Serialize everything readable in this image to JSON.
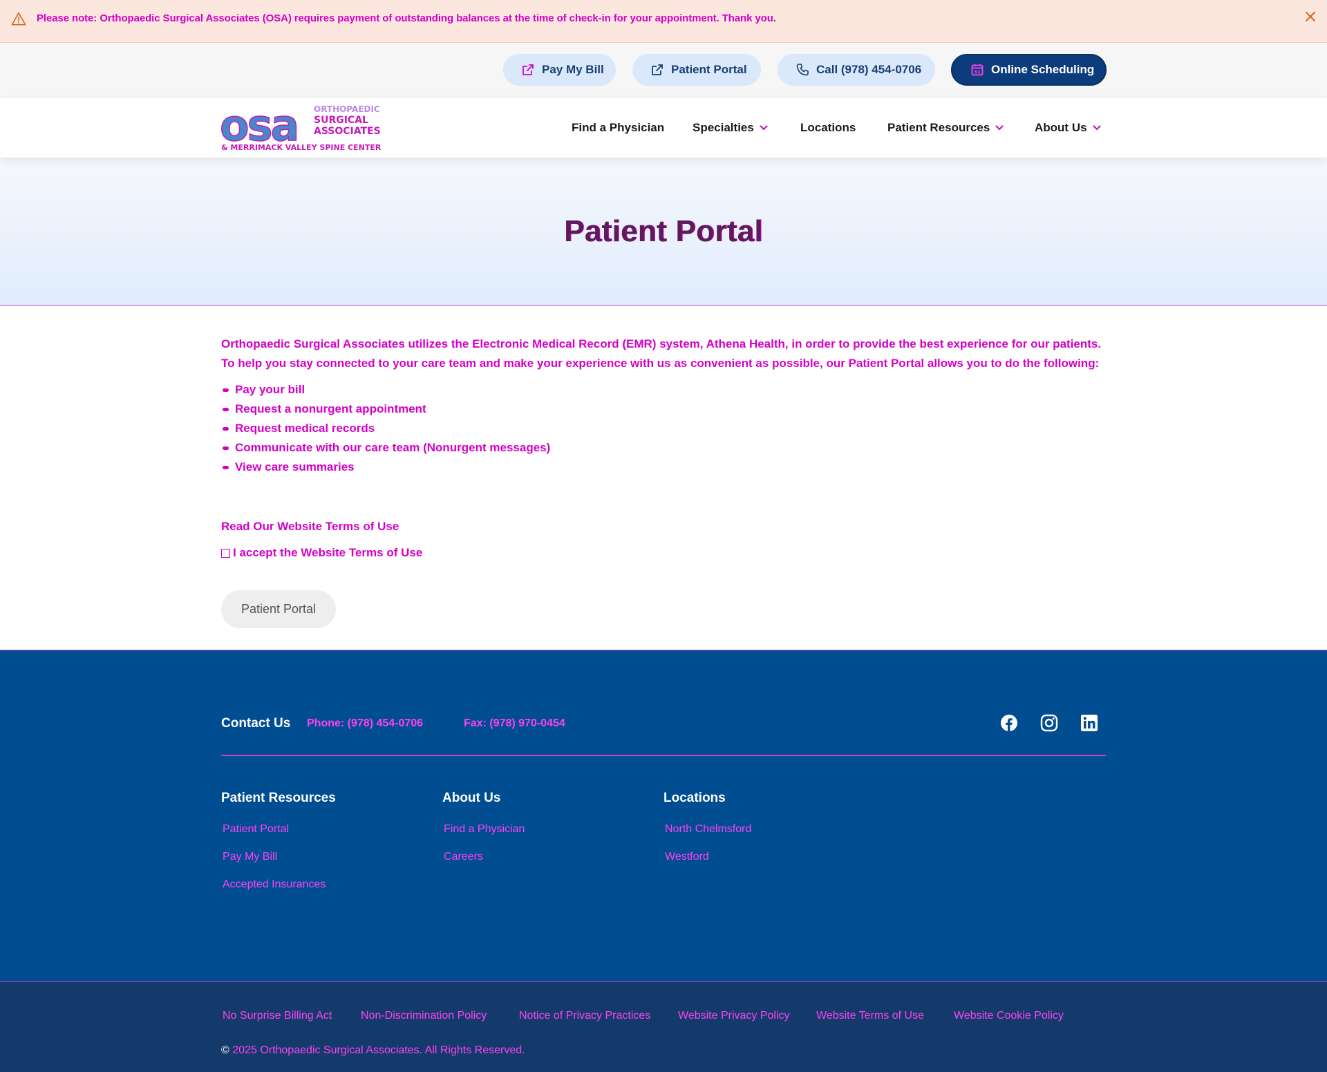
{
  "alert": {
    "message": "Please note: Orthopaedic Surgical Associates (OSA) requires payment of outstanding balances at the time of check-in for your appointment. Thank you."
  },
  "utility": {
    "pay_bill": "Pay My Bill",
    "patient_portal": "Patient Portal",
    "call": "Call (978) 454-0706",
    "scheduling": "Online Scheduling"
  },
  "logo": {
    "mark": "osa",
    "line1": "ORTHOPAEDIC",
    "line2": "SURGICAL",
    "line3": "ASSOCIATES",
    "line4": "& MERRIMACK VALLEY SPINE CENTER"
  },
  "nav": {
    "find_physician": "Find a Physician",
    "specialties": "Specialties",
    "locations": "Locations",
    "patient_resources": "Patient Resources",
    "about_us": "About Us"
  },
  "hero": {
    "title": "Patient Portal"
  },
  "main": {
    "intro": "Orthopaedic Surgical Associates utilizes the Electronic Medical Record (EMR) system, Athena Health, in order to provide the best experience for our patients. To help you stay connected to your care team and make your experience with us as convenient as possible, our Patient Portal allows you to do the following:",
    "bullets": [
      "Pay your bill",
      "Request a nonurgent appointment",
      "Request medical records",
      "Communicate with our care team (Nonurgent messages)",
      "View care summaries"
    ],
    "terms_link": "Read Our Website Terms of Use",
    "accept_label": "I accept the Website Terms of Use",
    "portal_button": "Patient Portal"
  },
  "footer": {
    "contact_title": "Contact Us",
    "phone": "Phone: (978) 454-0706",
    "fax": "Fax: (978) 970-0454",
    "columns": [
      {
        "title": "Patient Resources",
        "links": [
          "Patient Portal",
          "Pay My Bill",
          "Accepted Insurances"
        ]
      },
      {
        "title": "About Us",
        "links": [
          "Find a Physician",
          "Careers"
        ]
      },
      {
        "title": "Locations",
        "links": [
          "North Chelmsford",
          "Westford"
        ]
      }
    ],
    "policies": [
      "No Surprise Billing Act",
      "Non-Discrimination Policy",
      "Notice of Privacy Practices",
      "Website Privacy Policy",
      "Website Terms of Use",
      "Website Cookie Policy"
    ],
    "copyright_symbol": "©",
    "copyright": "2025 Orthopaedic Surgical Associates. All Rights Reserved."
  },
  "colors": {
    "brand_navy": "#0d3c7c",
    "footer_blue": "#014d92",
    "bottom_bar": "#143a6b",
    "accent_magenta": "#d400c8",
    "pill_blue": "#d9e8fb"
  }
}
